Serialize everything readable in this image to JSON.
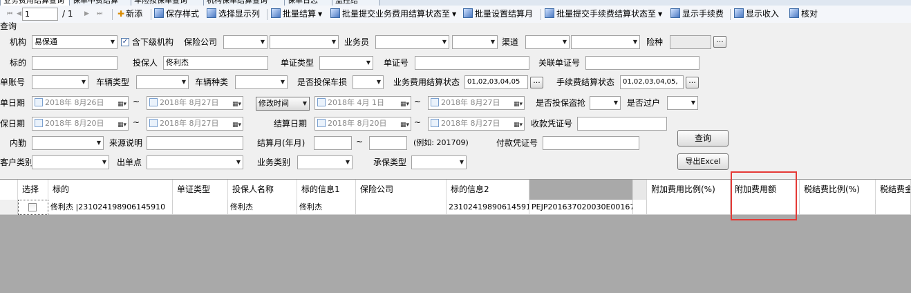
{
  "tabs": [
    "业务费用结算查询",
    "保单中费结算",
    "车险按保单查询",
    "机构保单结算查询",
    "保单日志",
    "监控结"
  ],
  "toolbar": {
    "page_current": "1",
    "page_total": "/ 1",
    "nav_first": "⏮",
    "nav_prev": "◀",
    "nav_next": "▶",
    "nav_last": "⏭",
    "new": "新添",
    "save_style": "保存样式",
    "select_columns": "选择显示列",
    "batch_settle": "批量结算",
    "batch_submit_business": "批量提交业务费用结算状态至",
    "batch_set_month": "批量设置结算月",
    "batch_submit_fee": "批量提交手续费结算状态至",
    "show_fee": "显示手续费",
    "show_income": "显示收入",
    "verify": "核对"
  },
  "query": {
    "section_title": "查询",
    "org_label": "机构",
    "org_value": "易保通",
    "include_sub_label": "含下级机构",
    "insurer_label": "保险公司",
    "agent_label": "业务员",
    "channel_label": "渠道",
    "coverage_label": "险种",
    "subject_label": "标的",
    "insured_label": "投保人",
    "insured_value": "佟利杰",
    "doc_type_label": "单证类型",
    "doc_no_label": "单证号",
    "rel_doc_label": "关联单证号",
    "account_label": "单账号",
    "vehicle_type_label": "车辆类型",
    "vehicle_kind_label": "车辆种类",
    "damage_label": "是否投保车损",
    "biz_status_label": "业务费用结算状态",
    "biz_status_value": "01,02,03,04,05",
    "fee_status_label": "手续费结算状态",
    "fee_status_value": "01,02,03,04,05,",
    "ellipsis": "...",
    "order_date_label": "单日期",
    "order_date_from": "2018年 8月26日",
    "order_date_to": "2018年 8月27日",
    "mod_time_label": "修改时间",
    "mod_date_from": "2018年 4月 1日",
    "mod_date_to": "2018年 8月27日",
    "theft_label": "是否投保盗抢",
    "transfer_label": "是否过户",
    "ins_date_label": "保日期",
    "ins_date_from": "2018年 8月20日",
    "ins_date_to": "2018年 8月27日",
    "settle_date_label": "结算日期",
    "settle_date_from": "2018年 8月20日",
    "settle_date_to": "2018年 8月27日",
    "receipt_label": "收款凭证号",
    "tilde": "~",
    "internal_label": "内勤",
    "source_label": "来源说明",
    "settle_month_label": "结算月(年月)",
    "example": "(例如: 201709)",
    "pay_voucher_label": "付款凭证号",
    "customer_type_label": "客户类别",
    "outlet_label": "出单点",
    "biz_type_label": "业务类别",
    "underwrite_label": "承保类型",
    "search_button": "查询",
    "export_button": "导出Excel"
  },
  "grid": {
    "headers": [
      "选择",
      "标的",
      "单证类型",
      "投保人名称",
      "标的信息1",
      "保险公司",
      "标的信息2",
      "",
      "附加费用比例(%)",
      "附加费用额",
      "税结费比例(%)",
      "税结费金"
    ],
    "row": {
      "subject": "佟利杰 |231024198906145910",
      "doc_type": "",
      "insured": "佟利杰",
      "info1": "佟利杰",
      "insurer": "",
      "info2": "231024198906145910",
      "policy": "PEJP201637020030E00167",
      "extra_ratio": "",
      "extra_amount": "",
      "tax_ratio": "",
      "tax_amount": ""
    }
  }
}
